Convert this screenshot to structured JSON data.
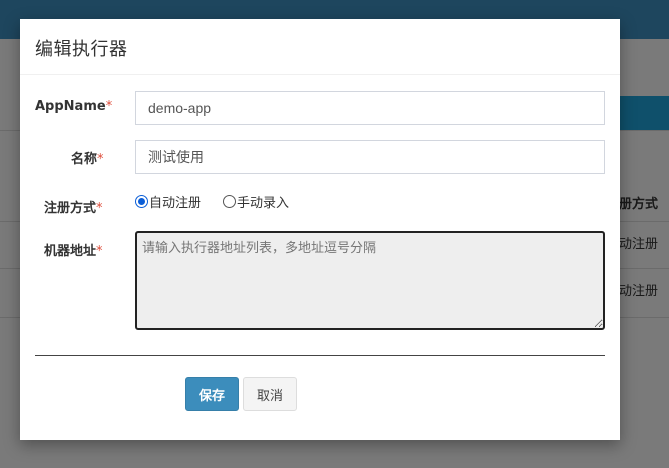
{
  "background": {
    "column_header": "册方式",
    "rows": [
      "动注册",
      "动注册"
    ]
  },
  "modal": {
    "title": "编辑执行器",
    "fields": {
      "appname": {
        "label": "AppName",
        "required_mark": "*",
        "value": "demo-app"
      },
      "name": {
        "label": "名称",
        "required_mark": "*",
        "value": "测试使用"
      },
      "register_type": {
        "label": "注册方式",
        "required_mark": "*",
        "options": [
          {
            "label": "自动注册",
            "checked": true
          },
          {
            "label": "手动录入",
            "checked": false
          }
        ]
      },
      "address": {
        "label": "机器地址",
        "required_mark": "*",
        "placeholder": "请输入执行器地址列表，多地址逗号分隔",
        "value": ""
      }
    },
    "buttons": {
      "save": "保存",
      "cancel": "取消"
    }
  },
  "colors": {
    "primary": "#3c8dbc",
    "required": "#dd4b39",
    "topbar": "#3c8dbc"
  }
}
